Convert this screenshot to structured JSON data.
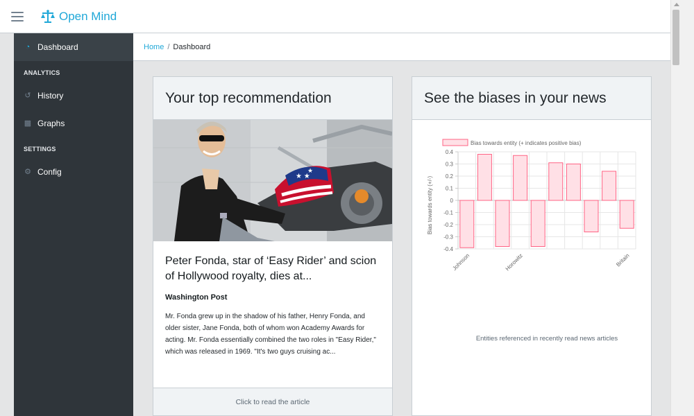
{
  "app": {
    "brand_name": "Open Mind",
    "icons": {
      "menu": "hamburger-icon",
      "brand": "scales-icon"
    }
  },
  "sidebar": {
    "items": [
      {
        "label": "Dashboard",
        "icon": "speedometer-icon",
        "active": true
      },
      {
        "section": "ANALYTICS"
      },
      {
        "label": "History",
        "icon": "history-icon"
      },
      {
        "label": "Graphs",
        "icon": "chart-icon"
      },
      {
        "section": "SETTINGS"
      },
      {
        "label": "Config",
        "icon": "gears-icon"
      }
    ]
  },
  "breadcrumb": {
    "home": "Home",
    "separator": "/",
    "current": "Dashboard"
  },
  "recommendation": {
    "header": "Your top recommendation",
    "headline": "Peter Fonda, star of ‘Easy Rider’ and scion of Hollywood royalty, dies at...",
    "source": "Washington Post",
    "excerpt": "Mr. Fonda grew up in the shadow of his father, Henry Fonda, and older sister, Jane Fonda, both of whom won Academy Awards for acting. Mr. Fonda essentially combined the two roles in \"Easy Rider,\" which was released in 1969. \"It's two guys cruising ac...",
    "footer": "Click to read the article"
  },
  "bias_card": {
    "header": "See the biases in your news",
    "caption": "Entities referenced in recently read news articles"
  },
  "chart_data": {
    "type": "bar",
    "legend": "Bias towards entity (+ indicates positive bias)",
    "legend_position": "top",
    "ylabel": "Bias towards entity (+/-)",
    "xlabel": "Entities referenced in recently read news articles",
    "ylim": [
      -0.4,
      0.4
    ],
    "yticks": [
      0.4,
      0.3,
      0.2,
      0.1,
      0,
      -0.1,
      -0.2,
      -0.3,
      -0.4
    ],
    "ytick_labels": [
      "0.4",
      "0.3",
      "0.2",
      "0.1",
      "0",
      "-0.1",
      "-0.2",
      "-0.3",
      "-0.4"
    ],
    "x_tick_labels": [
      "Johnson",
      "Horowitz",
      "Britain"
    ],
    "x_tick_label_positions": [
      0,
      3,
      9
    ],
    "values": [
      -0.39,
      0.38,
      -0.38,
      0.37,
      -0.38,
      0.31,
      0.3,
      -0.26,
      0.24,
      -0.23
    ],
    "grid": true,
    "colors": {
      "fill": "#ffe0e6",
      "stroke": "#ff6384"
    }
  }
}
